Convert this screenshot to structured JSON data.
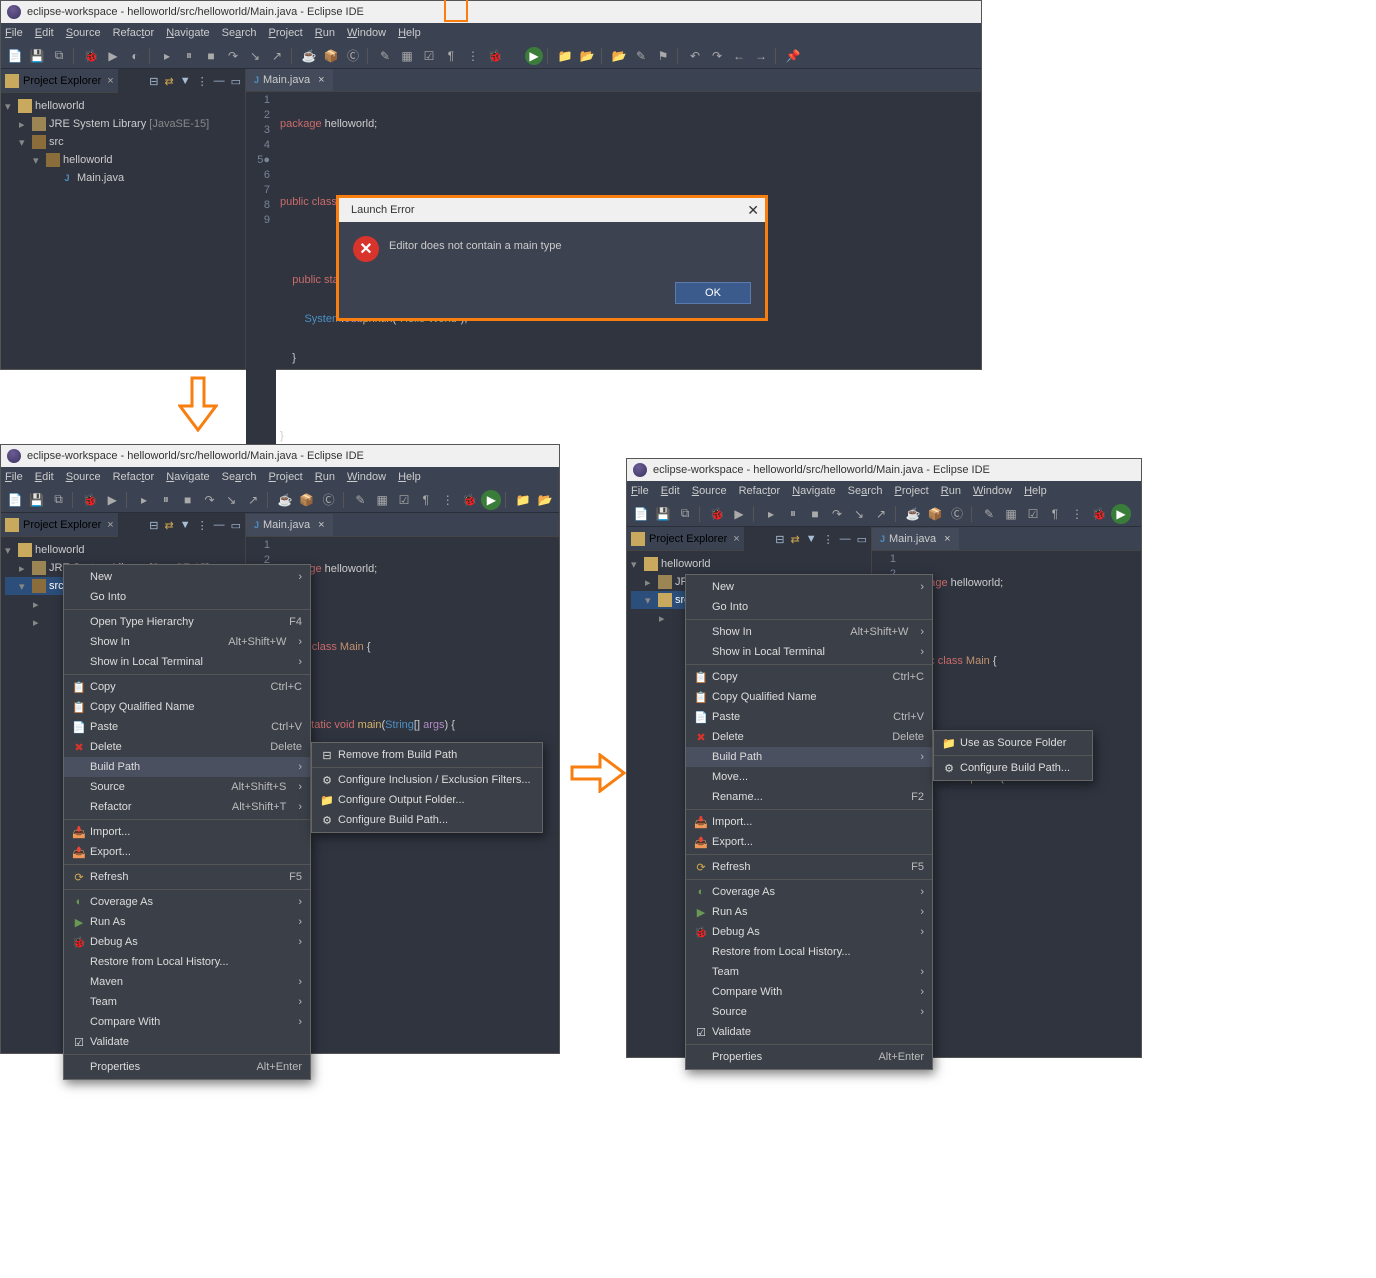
{
  "title1": "eclipse-workspace - helloworld/src/helloworld/Main.java - Eclipse IDE",
  "menus": [
    "File",
    "Edit",
    "Source",
    "Refactor",
    "Navigate",
    "Search",
    "Project",
    "Run",
    "Window",
    "Help"
  ],
  "explorer_title": "Project Explorer",
  "editor_tab": "Main.java",
  "tree": {
    "project": "helloworld",
    "jre": "JRE System Library",
    "jre_tag": "[JavaSE-15]",
    "src": "src",
    "pkg": "helloworld",
    "file": "Main.java"
  },
  "code": {
    "l1": {
      "a": "package ",
      "b": "helloworld;"
    },
    "l3": {
      "a": "public class ",
      "b": "Main ",
      "c": "{"
    },
    "l5": {
      "a": "    public static void ",
      "b": "main",
      "c": "(",
      "d": "String",
      "e": "[] ",
      "f": "args",
      "g": ") {"
    },
    "l6": {
      "a": "        ",
      "b": "System",
      "c": ".",
      "d": "out",
      "e": ".",
      "f": "println",
      "g": "(",
      "h": "\"Hello World\"",
      "i": ");"
    },
    "l7": "    }",
    "l9": "}"
  },
  "dialog": {
    "title": "Launch Error",
    "msg": "Editor does not contain a main type",
    "ok": "OK"
  },
  "ctx1": {
    "new": "New",
    "go": "Go Into",
    "oth": "Open Type Hierarchy",
    "oth_sc": "F4",
    "showin": "Show In",
    "showin_sc": "Alt+Shift+W",
    "showlocal": "Show in Local Terminal",
    "copy": "Copy",
    "copy_sc": "Ctrl+C",
    "copyq": "Copy Qualified Name",
    "paste": "Paste",
    "paste_sc": "Ctrl+V",
    "delete": "Delete",
    "delete_sc": "Delete",
    "build": "Build Path",
    "source": "Source",
    "source_sc": "Alt+Shift+S",
    "refactor": "Refactor",
    "refactor_sc": "Alt+Shift+T",
    "import": "Import...",
    "export": "Export...",
    "refresh": "Refresh",
    "refresh_sc": "F5",
    "cov": "Coverage As",
    "run": "Run As",
    "debug": "Debug As",
    "restore": "Restore from Local History...",
    "maven": "Maven",
    "team": "Team",
    "compare": "Compare With",
    "validate": "Validate",
    "props": "Properties",
    "props_sc": "Alt+Enter"
  },
  "sub1": {
    "remove": "Remove from Build Path",
    "cfgie": "Configure Inclusion / Exclusion Filters...",
    "cfgout": "Configure Output Folder...",
    "cfgbp": "Configure Build Path..."
  },
  "ctx2": {
    "new": "New",
    "go": "Go Into",
    "showin": "Show In",
    "showin_sc": "Alt+Shift+W",
    "showlocal": "Show in Local Terminal",
    "copy": "Copy",
    "copy_sc": "Ctrl+C",
    "copyq": "Copy Qualified Name",
    "paste": "Paste",
    "paste_sc": "Ctrl+V",
    "delete": "Delete",
    "delete_sc": "Delete",
    "build": "Build Path",
    "move": "Move...",
    "rename": "Rename...",
    "rename_sc": "F2",
    "import": "Import...",
    "export": "Export...",
    "refresh": "Refresh",
    "refresh_sc": "F5",
    "cov": "Coverage As",
    "run": "Run As",
    "debug": "Debug As",
    "restore": "Restore from Local History...",
    "team": "Team",
    "compare": "Compare With",
    "source": "Source",
    "validate": "Validate",
    "props": "Properties",
    "props_sc": "Alt+Enter"
  },
  "sub2": {
    "usesrc": "Use as Source Folder",
    "cfgbp": "Configure Build Path..."
  }
}
